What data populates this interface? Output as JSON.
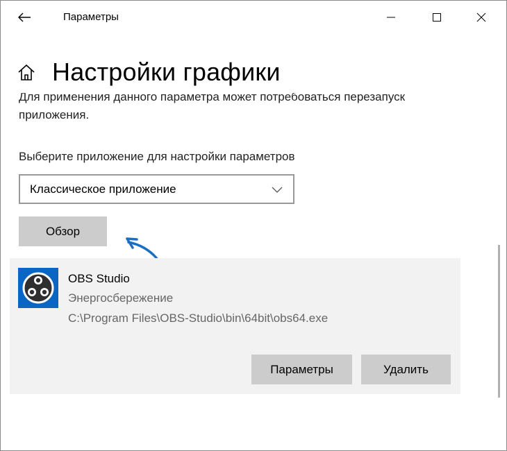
{
  "window": {
    "title": "Параметры",
    "controls": {
      "minimize": "minimize-icon",
      "maximize": "maximize-icon",
      "close": "close-icon"
    },
    "back_icon": "back-arrow-icon"
  },
  "header": {
    "icon": "home-icon",
    "title": "Настройки графики"
  },
  "description": "Для применения данного параметра может потребоваться перезапуск приложения.",
  "app_select": {
    "label": "Выберите приложение для настройки параметров",
    "selected": "Классическое приложение",
    "chevron_icon": "chevron-down-icon"
  },
  "browse_button": "Обзор",
  "app_entry": {
    "name": "OBS Studio",
    "mode": "Энергосбережение",
    "path": "C:\\Program Files\\OBS-Studio\\bin\\64bit\\obs64.exe",
    "icon": "obs-logo-icon",
    "options_button": "Параметры",
    "remove_button": "Удалить"
  },
  "colors": {
    "accent": "#0a66c2",
    "button_bg": "#cccccc",
    "card_bg": "#f2f2f2",
    "secondary_text": "#666666"
  }
}
